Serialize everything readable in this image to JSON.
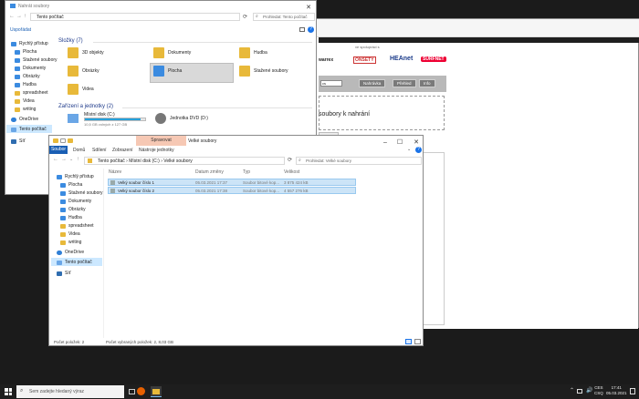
{
  "win1": {
    "title": "Nahrát soubory",
    "address": "Tento počítač",
    "search_placeholder": "Prohledat: Tento počítač",
    "organize": "Uspořádat",
    "sidebar": [
      "Rychlý přístup",
      "Plocha",
      "Stažené soubory",
      "Dokumenty",
      "Obrázky",
      "Hudba",
      "spreadsheet",
      "Videa",
      "writing",
      "OneDrive",
      "Tento počítač",
      "Síť"
    ],
    "folders_header": "Složky (7)",
    "folders": [
      "3D objekty",
      "Dokumenty",
      "Hudba",
      "Obrázky",
      "Plocha",
      "Stažené soubory",
      "Videa"
    ],
    "devices_header": "Zařízení a jednotky (2)",
    "drive_c": {
      "name": "Místní disk (C:)",
      "free": "10,5 GB volných z 127 GB",
      "fill": 0.92
    },
    "drive_d": "Jednotka DVD (D:)"
  },
  "browser": {
    "partner_label": "ve spolupráci s",
    "logos": [
      "warrex",
      "ONSETY",
      "HEAnet",
      "SURFNET"
    ],
    "tabs": [
      "Nahrávka",
      "Přehled",
      "Info",
      "Odkazy"
    ],
    "drop_text": "soubory k nahrání",
    "drop_btn": [
      "brat",
      "ubory"
    ]
  },
  "win2": {
    "title": "Velké soubory",
    "ribbon_manage": "Spravovat",
    "ribbon_tools": "Nástroje jednotky",
    "ribbon_tabs": [
      "Soubor",
      "Domů",
      "Sdílení",
      "Zobrazení"
    ],
    "breadcrumb": [
      "Tento počítač",
      "Místní disk (C:)",
      "Velké soubory"
    ],
    "search_placeholder": "Prohledat: Velké soubory",
    "sidebar": [
      "Rychlý přístup",
      "Plocha",
      "Stažené soubory",
      "Dokumenty",
      "Obrázky",
      "Hudba",
      "spreadsheet",
      "Videa",
      "writing",
      "OneDrive",
      "Tento počítač",
      "Síť"
    ],
    "columns": [
      "Název",
      "Datum změny",
      "Typ",
      "Velikost"
    ],
    "rows": [
      {
        "name": "Velký soubor číslo 1",
        "date": "05.03.2021 17:37",
        "type": "Soubor bitové kop...",
        "size": "3 875 424 kB"
      },
      {
        "name": "Velký soubor číslo 2",
        "date": "05.03.2021 17:38",
        "type": "Soubor bitové kop...",
        "size": "4 557 276 kB"
      }
    ],
    "status": "Počet položek: 2",
    "status_sel": "Počet vybraných položek: 2, 8,03 GB"
  },
  "taskbar": {
    "search": "Sem zadejte hledaný výraz",
    "lang": "CES",
    "lang2": "CSQ",
    "time": "17:41",
    "date": "05.03.2021"
  }
}
